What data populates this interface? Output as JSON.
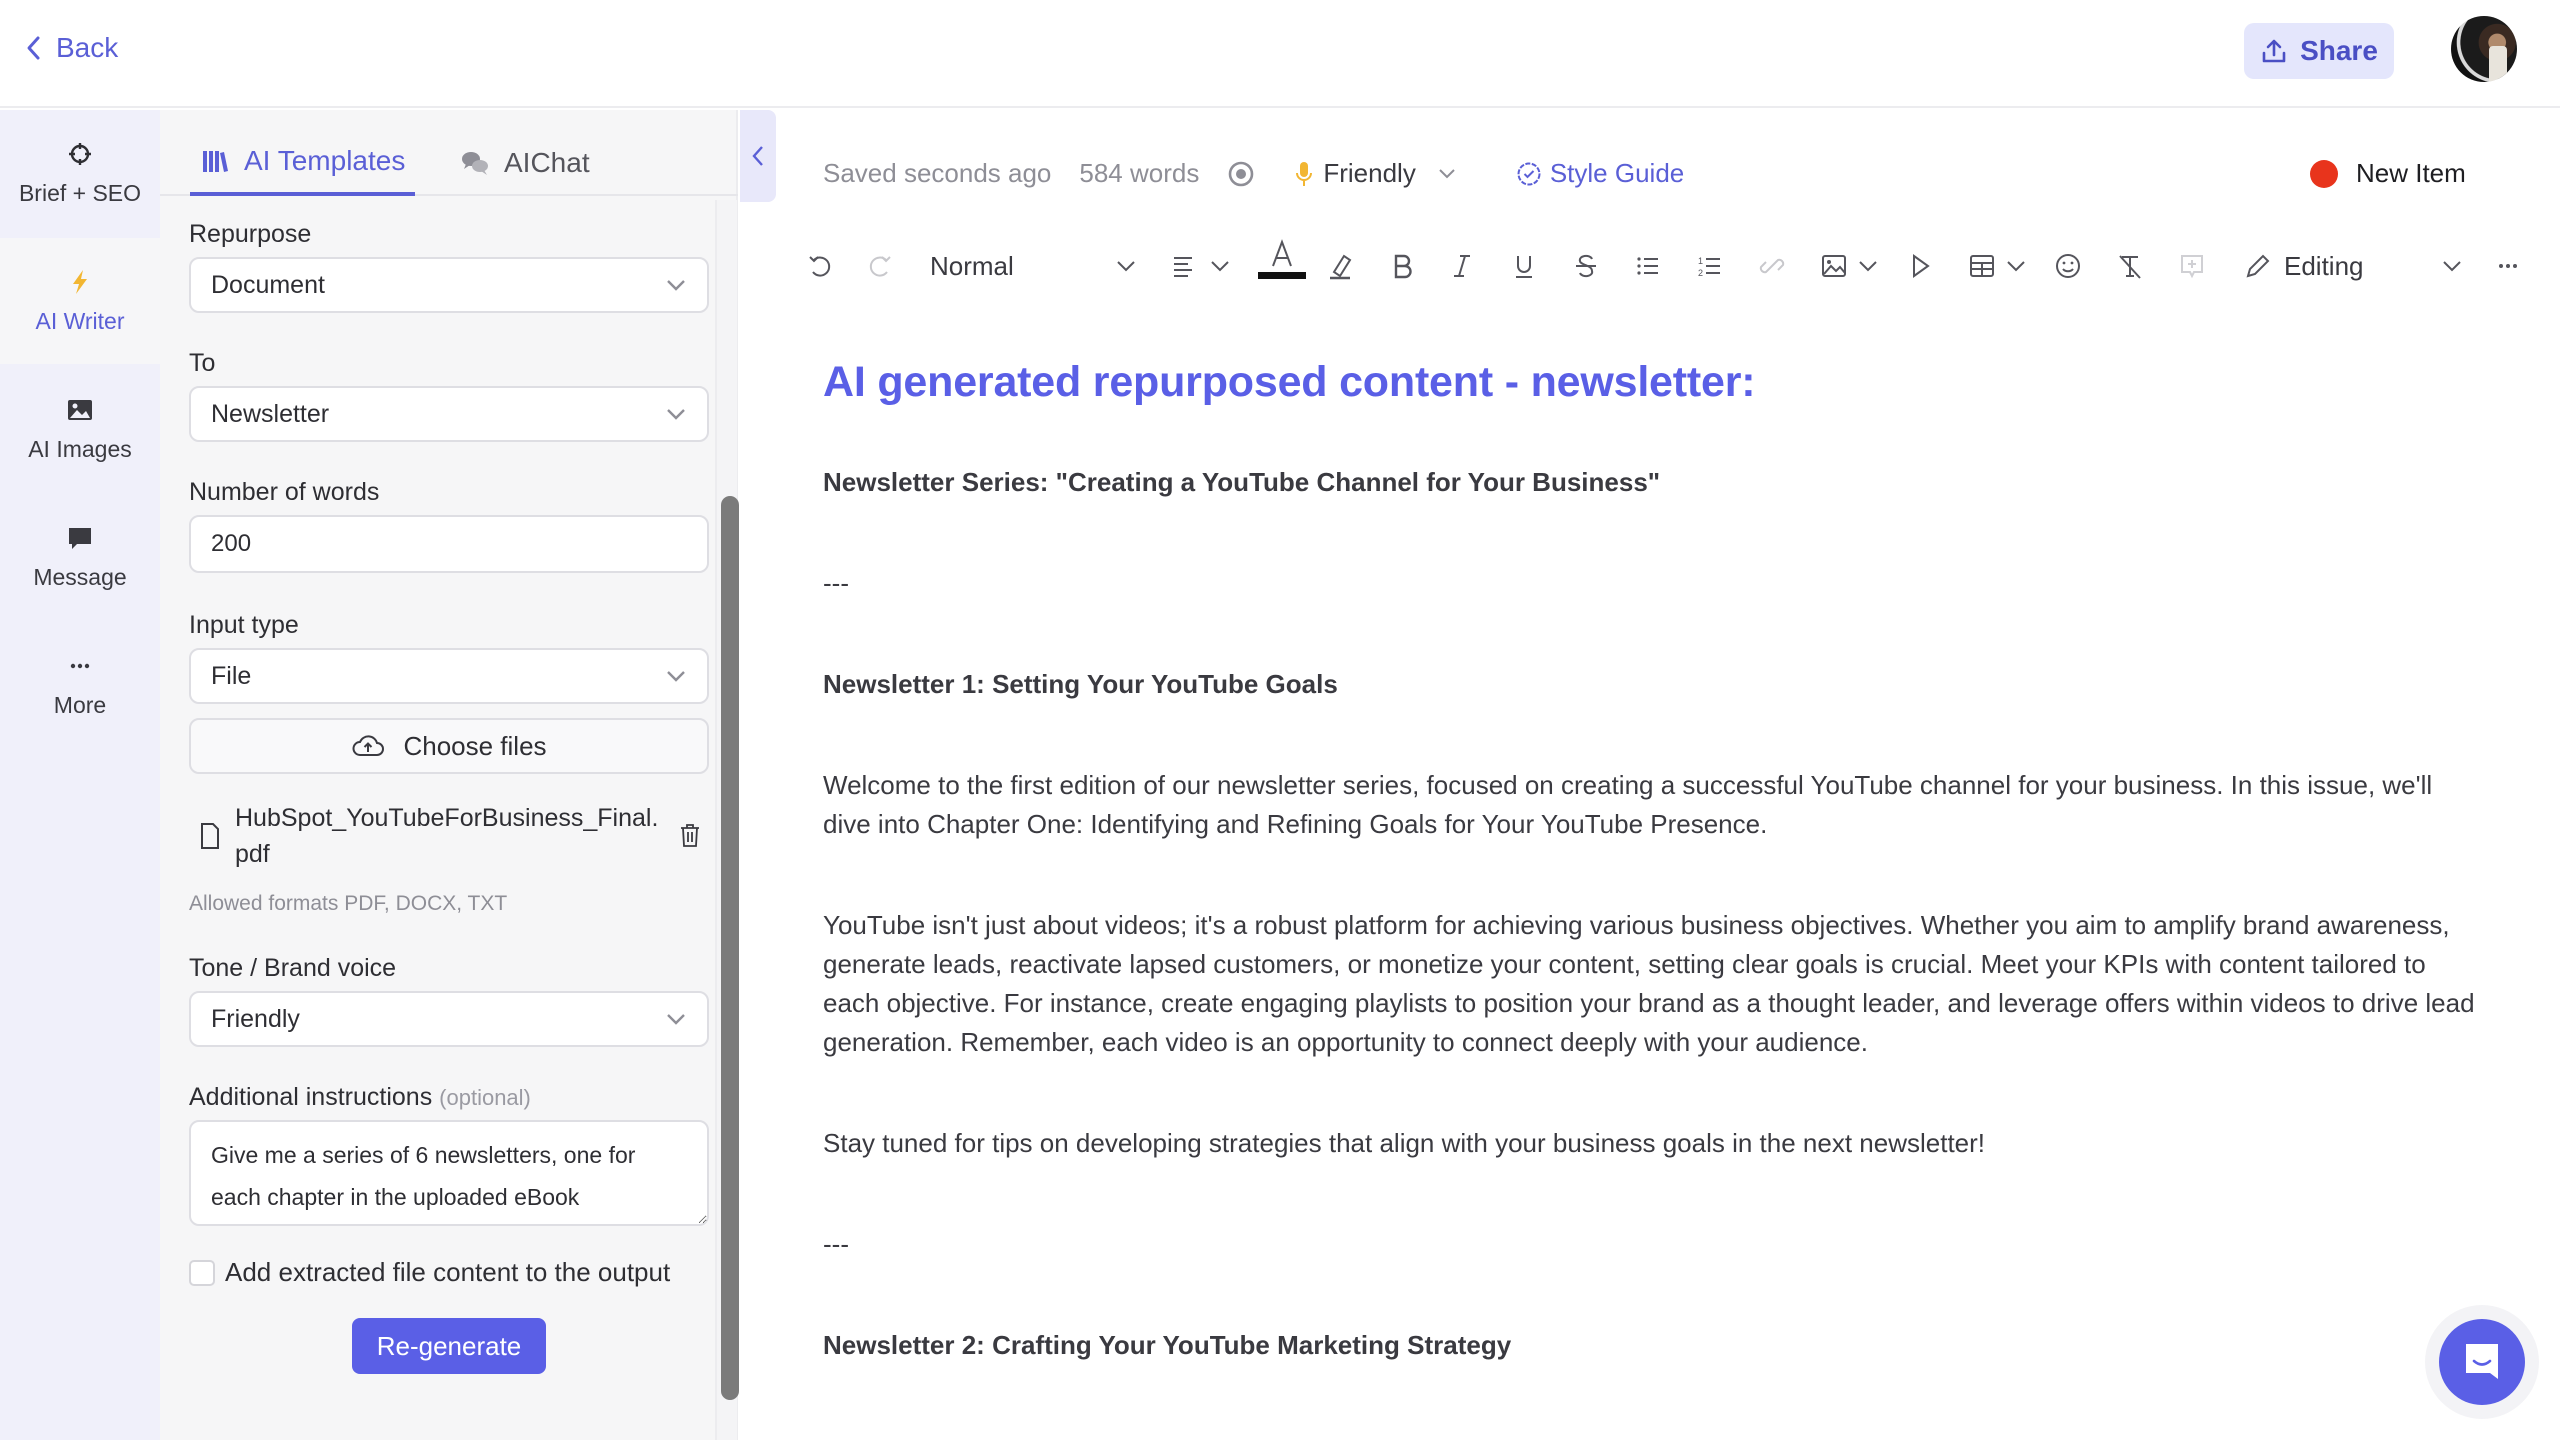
{
  "topbar": {
    "back_label": "Back",
    "share_label": "Share",
    "avatar_alt": "User avatar"
  },
  "leftnav": {
    "items": [
      {
        "label": "Brief + SEO",
        "icon": "crosshair-icon",
        "active": false
      },
      {
        "label": "AI Writer",
        "icon": "lightning-icon",
        "active": true
      },
      {
        "label": "AI Images",
        "icon": "image-icon",
        "active": false
      },
      {
        "label": "Message",
        "icon": "message-icon",
        "active": false
      },
      {
        "label": "More",
        "icon": "more-icon",
        "active": false
      }
    ]
  },
  "panel": {
    "tabs": [
      {
        "label": "AI Templates",
        "active": true
      },
      {
        "label": "AIChat",
        "active": false
      }
    ],
    "form": {
      "repurpose_label": "Repurpose",
      "repurpose_value": "Document",
      "to_label": "To",
      "to_value": "Newsletter",
      "words_label": "Number of words",
      "words_value": "200",
      "input_type_label": "Input type",
      "input_type_value": "File",
      "choose_files_label": "Choose files",
      "file_name": "HubSpot_YouTubeForBusiness_Final.pdf",
      "allowed_formats": "Allowed formats PDF, DOCX, TXT",
      "tone_label": "Tone / Brand voice",
      "tone_value": "Friendly",
      "instructions_label": "Additional instructions",
      "instructions_optional": "(optional)",
      "instructions_value": "Give me a series of 6 newsletters, one for each chapter in the uploaded eBook",
      "checkbox_label": "Add extracted file content to the output",
      "checkbox_checked": false,
      "regenerate_label": "Re-generate"
    }
  },
  "editor": {
    "status": {
      "saved": "Saved seconds ago",
      "word_count": "584 words",
      "tone": "Friendly",
      "style_guide": "Style Guide",
      "new_item": "New Item"
    },
    "toolbar": {
      "paragraph_style": "Normal",
      "mode": "Editing"
    },
    "document": {
      "title": "AI generated repurposed content - newsletter:",
      "series_heading": "Newsletter Series: \"Creating a YouTube Channel for Your Business\"",
      "separator": "---",
      "newsletter1_heading": "Newsletter 1: Setting Your YouTube Goals",
      "para1": "Welcome to the first edition of our newsletter series, focused on creating a successful YouTube channel for your business. In this issue, we'll dive into Chapter One: Identifying and Refining Goals for Your YouTube Presence.",
      "para2": "YouTube isn't just about videos; it's a robust platform for achieving various business objectives. Whether you aim to amplify brand awareness, generate leads, reactivate lapsed customers, or monetize your content, setting clear goals is crucial. Meet your KPIs with content tailored to each objective. For instance, create engaging playlists to position your brand as a thought leader, and leverage offers within videos to drive lead generation. Remember, each video is an opportunity to connect deeply with your audience.",
      "para3": "Stay tuned for tips on developing strategies that align with your business goals in the next newsletter!",
      "separator2": "---",
      "newsletter2_heading": "Newsletter 2: Crafting Your YouTube Marketing Strategy"
    }
  },
  "colors": {
    "accent": "#5a5fe6",
    "accent_text": "#5a5fd6",
    "new_item_dot": "#e8341c",
    "tone_mic": "#f2b632"
  }
}
